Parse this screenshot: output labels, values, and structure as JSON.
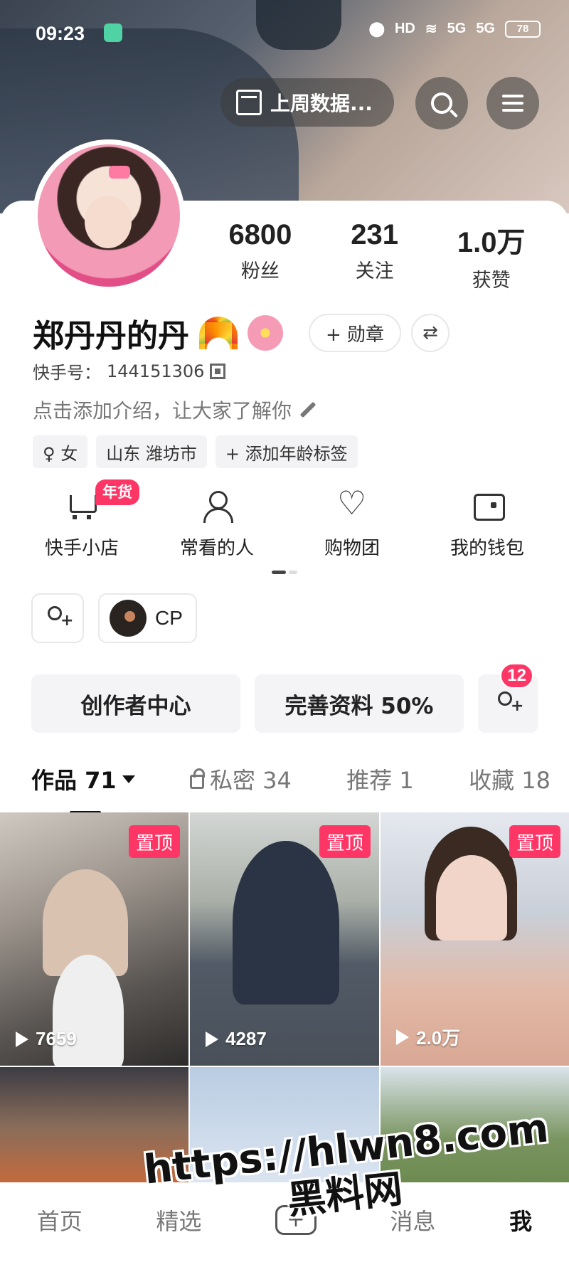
{
  "status_bar": {
    "time": "09:23",
    "network_labels": [
      "HD",
      "5G",
      "5G"
    ],
    "battery": "78"
  },
  "header": {
    "week_data_label": "上周数据...",
    "search_icon": "search-icon",
    "menu_icon": "menu-icon"
  },
  "profile": {
    "stats": [
      {
        "value": "6800",
        "label": "粉丝"
      },
      {
        "value": "231",
        "label": "关注"
      },
      {
        "value": "1.0万",
        "label": "获赞"
      }
    ],
    "name": "郑丹丹的丹",
    "medal_label": "+ 勋章",
    "kuaishou_id_label": "快手号：",
    "kuaishou_id": "144151306",
    "intro": "点击添加介绍，让大家了解你",
    "tags": [
      "♀ 女",
      "山东 潍坊市",
      "+ 添加年龄标签"
    ]
  },
  "services": [
    {
      "label": "快手小店",
      "icon": "cart-icon",
      "badge": "年货"
    },
    {
      "label": "常看的人",
      "icon": "person-clock-icon"
    },
    {
      "label": "购物团",
      "icon": "heart-icon"
    },
    {
      "label": "我的钱包",
      "icon": "wallet-icon"
    }
  ],
  "friends_row": {
    "cp_label": "CP"
  },
  "actions": {
    "creator_center": "创作者中心",
    "complete_profile": "完善资料 50%",
    "friend_requests_count": "12"
  },
  "tabs": [
    {
      "label": "作品 71",
      "active": true
    },
    {
      "label": "私密 34"
    },
    {
      "label": "推荐 1"
    },
    {
      "label": "收藏 18"
    }
  ],
  "videos": [
    {
      "pinned": "置顶",
      "views": "7659"
    },
    {
      "pinned": "置顶",
      "views": "4287"
    },
    {
      "pinned": "置顶",
      "views": "2.0万"
    }
  ],
  "bottom_nav": {
    "home": "首页",
    "featured": "精选",
    "messages": "消息",
    "me": "我"
  },
  "watermark": {
    "url": "https://hlwn8.com",
    "text": "黑料网"
  },
  "colors": {
    "accent": "#fe3666",
    "text_primary": "#222222",
    "text_secondary": "#777777"
  }
}
